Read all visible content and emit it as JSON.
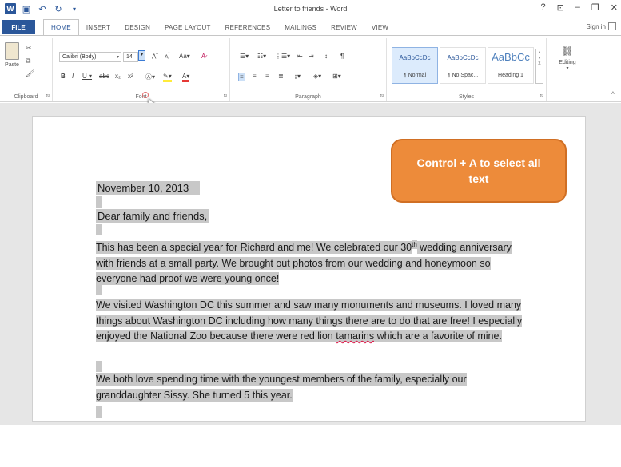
{
  "window": {
    "title": "Letter to friends - Word",
    "controls": [
      "?",
      "⊡",
      "–",
      "❐",
      "✕"
    ]
  },
  "tabs": {
    "file": "FILE",
    "items": [
      "HOME",
      "INSERT",
      "DESIGN",
      "PAGE LAYOUT",
      "REFERENCES",
      "MAILINGS",
      "REVIEW",
      "VIEW"
    ],
    "active": "HOME",
    "signin": "Sign in"
  },
  "ribbon": {
    "clipboard": {
      "paste_label": "Paste",
      "group_label": "Clipboard"
    },
    "font": {
      "font_name": "Calibri (Body)",
      "font_size": "14",
      "group_label": "Font"
    },
    "paragraph": {
      "group_label": "Paragraph"
    },
    "styles": {
      "items": [
        {
          "sample": "AaBbCcDc",
          "name": "¶ Normal"
        },
        {
          "sample": "AaBbCcDc",
          "name": "¶ No Spac..."
        },
        {
          "sample": "AaBbCc",
          "name": "Heading 1"
        }
      ],
      "group_label": "Styles"
    },
    "editing": {
      "label": "Editing"
    }
  },
  "document": {
    "date": "November 10, 2013",
    "greeting": "Dear family and friends,",
    "paragraphs": {
      "p1_a": "This has been a special year for Richard and me! We celebrated our 30",
      "p1_sup": "th",
      "p1_b": " wedding anniversary with friends at a small party.  We brought out photos from our wedding and honeymoon so everyone had proof we were young once!",
      "p2_a": "We visited Washington DC this summer and saw many monuments and museums.  I loved many things about Washington DC including how many things there are to do that are free!  I especially enjoyed the National Zoo because there were red lion ",
      "p2_spell": "tamarins",
      "p2_b": " which are a favorite of mine.",
      "p3": "We both love spending time with the youngest members of the family, especially our granddaughter Sissy.  She turned 5 this year."
    }
  },
  "callout": {
    "text": "Control + A to select all text",
    "color": "#ed8b3a"
  },
  "colors": {
    "accent": "#2b579a",
    "selection": "#c8c8c8"
  }
}
